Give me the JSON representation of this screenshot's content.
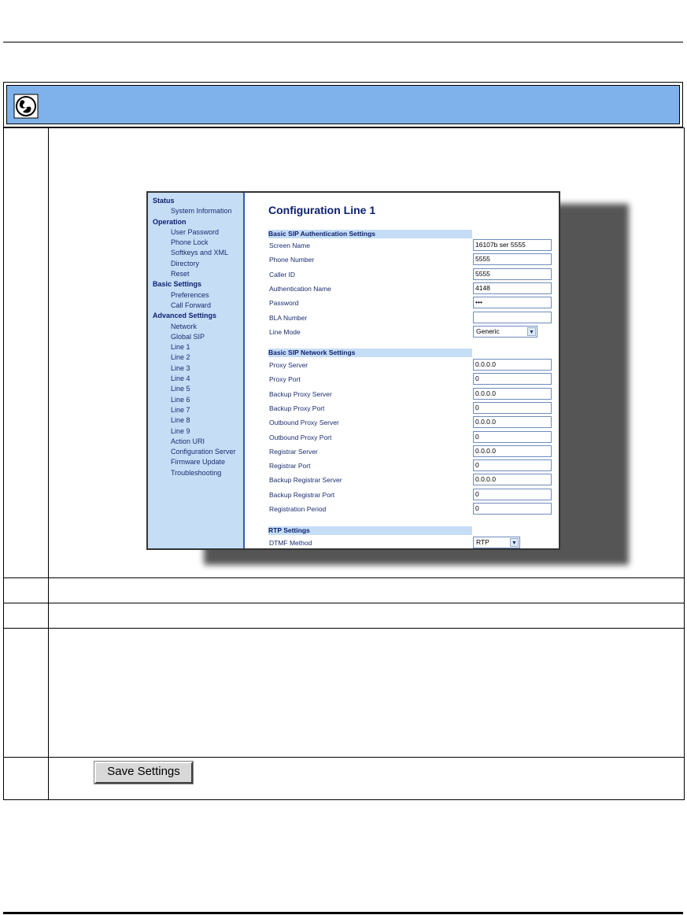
{
  "screenshot": {
    "title": "Configuration Line 1",
    "sidebar": [
      {
        "group": "Status",
        "items": [
          "System Information"
        ]
      },
      {
        "group": "Operation",
        "items": [
          "User Password",
          "Phone Lock",
          "Softkeys and XML",
          "Directory",
          "Reset"
        ]
      },
      {
        "group": "Basic Settings",
        "items": [
          "Preferences",
          "Call Forward"
        ]
      },
      {
        "group": "Advanced Settings",
        "items": [
          "Network",
          "Global SIP",
          "Line 1",
          "Line 2",
          "Line 3",
          "Line 4",
          "Line 5",
          "Line 6",
          "Line 7",
          "Line 8",
          "Line 9",
          "Action URI",
          "Configuration Server",
          "Firmware Update",
          "Troubleshooting"
        ]
      }
    ],
    "auth_section": "Basic SIP Authentication Settings",
    "auth_fields": [
      {
        "label": "Screen Name",
        "value": "16107b ser 5555"
      },
      {
        "label": "Phone Number",
        "value": "5555"
      },
      {
        "label": "Caller ID",
        "value": "5555"
      },
      {
        "label": "Authentication Name",
        "value": "4148"
      },
      {
        "label": "Password",
        "value": "•••"
      },
      {
        "label": "BLA Number",
        "value": ""
      }
    ],
    "line_mode": {
      "label": "Line Mode",
      "value": "Generic"
    },
    "network_section": "Basic SIP Network Settings",
    "network_fields": [
      {
        "label": "Proxy Server",
        "value": "0.0.0.0"
      },
      {
        "label": "Proxy Port",
        "value": "0"
      },
      {
        "label": "Backup Proxy Server",
        "value": "0.0.0.0"
      },
      {
        "label": "Backup Proxy Port",
        "value": "0"
      },
      {
        "label": "Outbound Proxy Server",
        "value": "0.0.0.0"
      },
      {
        "label": "Outbound Proxy Port",
        "value": "0"
      },
      {
        "label": "Registrar Server",
        "value": "0.0.0.0"
      },
      {
        "label": "Registrar Port",
        "value": "0"
      },
      {
        "label": "Backup Registrar Server",
        "value": "0.0.0.0"
      },
      {
        "label": "Backup Registrar Port",
        "value": "0"
      },
      {
        "label": "Registration Period",
        "value": "0"
      }
    ],
    "rtp_section": "RTP Settings",
    "dtmf": {
      "label": "DTMF Method",
      "value": "RTP"
    }
  },
  "save_button": "Save Settings",
  "icons": {
    "header": "globe-icon",
    "dropdown": "chevron-down-icon"
  },
  "colors": {
    "header_bar": "#7fb2ea",
    "sidebar": "#c6ddf6",
    "heading": "#0a1f6e"
  }
}
